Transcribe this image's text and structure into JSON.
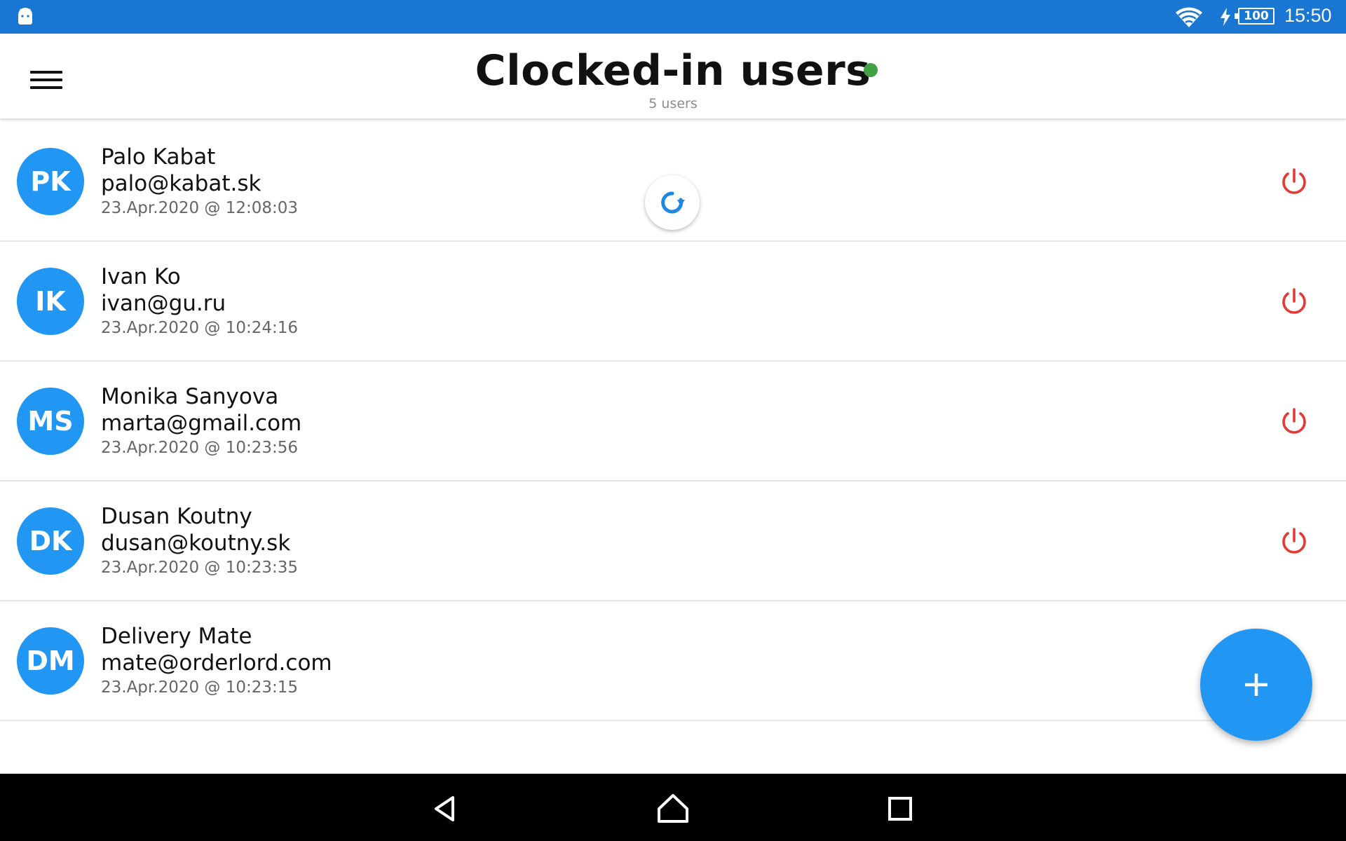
{
  "status_bar": {
    "time": "15:50",
    "battery_level": "100",
    "icons": [
      "android-icon",
      "wifi-icon",
      "charging-icon",
      "battery-icon"
    ]
  },
  "app_bar": {
    "title": "Clocked-in users",
    "subtitle": "5 users",
    "status_color": "#43a047"
  },
  "users": [
    {
      "initials": "PK",
      "name": "Palo Kabat",
      "email": "palo@kabat.sk",
      "clocked_in": "23.Apr.2020 @ 12:08:03"
    },
    {
      "initials": "IK",
      "name": "Ivan Ko",
      "email": "ivan@gu.ru",
      "clocked_in": "23.Apr.2020 @ 10:24:16"
    },
    {
      "initials": "MS",
      "name": "Monika Sanyova",
      "email": "marta@gmail.com",
      "clocked_in": "23.Apr.2020 @ 10:23:56"
    },
    {
      "initials": "DK",
      "name": "Dusan Koutny",
      "email": "dusan@koutny.sk",
      "clocked_in": "23.Apr.2020 @ 10:23:35"
    },
    {
      "initials": "DM",
      "name": "Delivery Mate",
      "email": "mate@orderlord.com",
      "clocked_in": "23.Apr.2020 @ 10:23:15"
    }
  ],
  "colors": {
    "primary": "#2196f3",
    "status_bar": "#1976d2",
    "power_icon": "#e53935"
  },
  "nav_bar": {
    "buttons": [
      "back-icon",
      "home-icon",
      "recents-icon"
    ]
  }
}
